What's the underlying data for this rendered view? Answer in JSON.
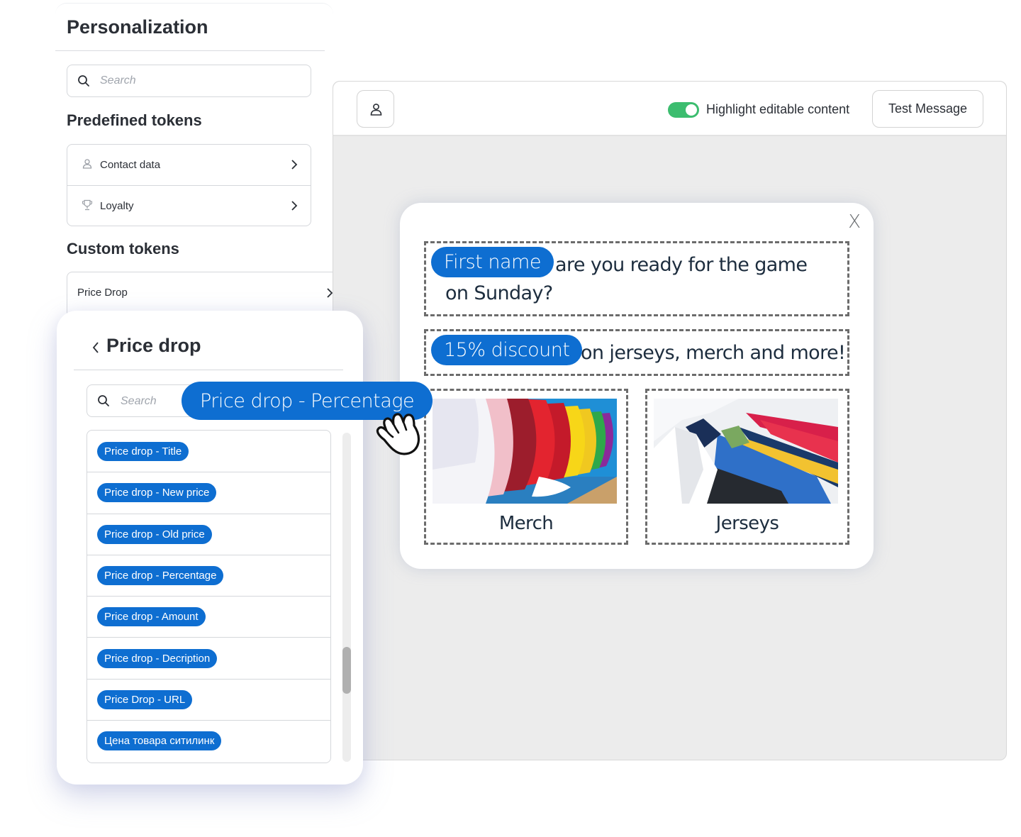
{
  "personalization": {
    "title": "Personalization",
    "search_placeholder": "Search",
    "predefined_heading": "Predefined tokens",
    "predefined_items": [
      {
        "label": "Contact data",
        "icon": "user-icon"
      },
      {
        "label": "Loyalty",
        "icon": "trophy-icon"
      }
    ],
    "custom_heading": "Custom tokens",
    "custom_items": [
      {
        "label": "Price Drop"
      }
    ]
  },
  "editor": {
    "toolbar": {
      "user_button_icon": "user-icon",
      "highlight_toggle_label": "Highlight editable content",
      "highlight_toggle_on": true,
      "test_message_label": "Test Message"
    },
    "colors": {
      "toggle_on": "#3cbd6f",
      "token_blue": "#0e6ed1"
    }
  },
  "message": {
    "close_label": "X",
    "block1": {
      "token": "First name",
      "text_line1": "are you ready for the game",
      "text_line2": "on Sunday?"
    },
    "block2": {
      "token": "15% discount",
      "text": "on jerseys, merch and more!"
    },
    "products": [
      {
        "caption": "Merch",
        "image": "colorful baseball caps"
      },
      {
        "caption": "Jerseys",
        "image": "sports jerseys on hangers"
      }
    ]
  },
  "price_drop_panel": {
    "back_icon": "chevron-left-icon",
    "title": "Price drop",
    "search_placeholder": "Search",
    "tokens": [
      "Price drop - Title",
      "Price drop - New price",
      "Price drop - Old price",
      "Price drop - Percentage",
      "Price drop - Amount",
      "Price drop - Decription",
      "Price Drop - URL",
      "Цена товара ситилинк"
    ]
  },
  "dragging_token": {
    "label": "Price drop - Percentage",
    "cursor_icon": "grab-hand-icon"
  }
}
